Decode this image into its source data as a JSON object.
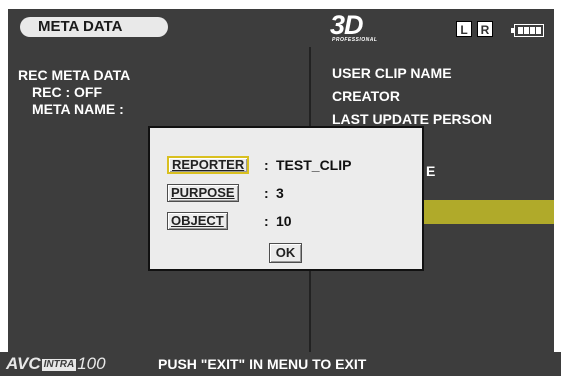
{
  "header": {
    "title": "META DATA",
    "logo_main": "3D",
    "logo_sub": "PROFESSIONAL",
    "channel_left": "L",
    "channel_right": "R"
  },
  "left_panel": {
    "heading": "REC META DATA",
    "rec_line": "REC : OFF",
    "meta_name_line": "META NAME :"
  },
  "right_panel": {
    "items": [
      "USER CLIP NAME",
      "CREATOR",
      "LAST UPDATE PERSON"
    ],
    "partial_item": "E"
  },
  "dialog": {
    "fields": [
      {
        "label": "REPORTER",
        "value": "TEST_CLIP",
        "selected": true
      },
      {
        "label": "PURPOSE",
        "value": "3",
        "selected": false
      },
      {
        "label": "OBJECT",
        "value": "10",
        "selected": false
      }
    ],
    "separator": ":",
    "ok_label": "OK"
  },
  "footer": {
    "codec_prefix": "AVC",
    "codec_badge": "INTRA",
    "codec_suffix": "100",
    "hint": "PUSH \"EXIT\" IN MENU TO EXIT"
  },
  "colors": {
    "background": "#3d3d3d",
    "highlight": "#b0aa2a",
    "selection_border": "#d9c020",
    "dialog_bg": "#ececec"
  }
}
